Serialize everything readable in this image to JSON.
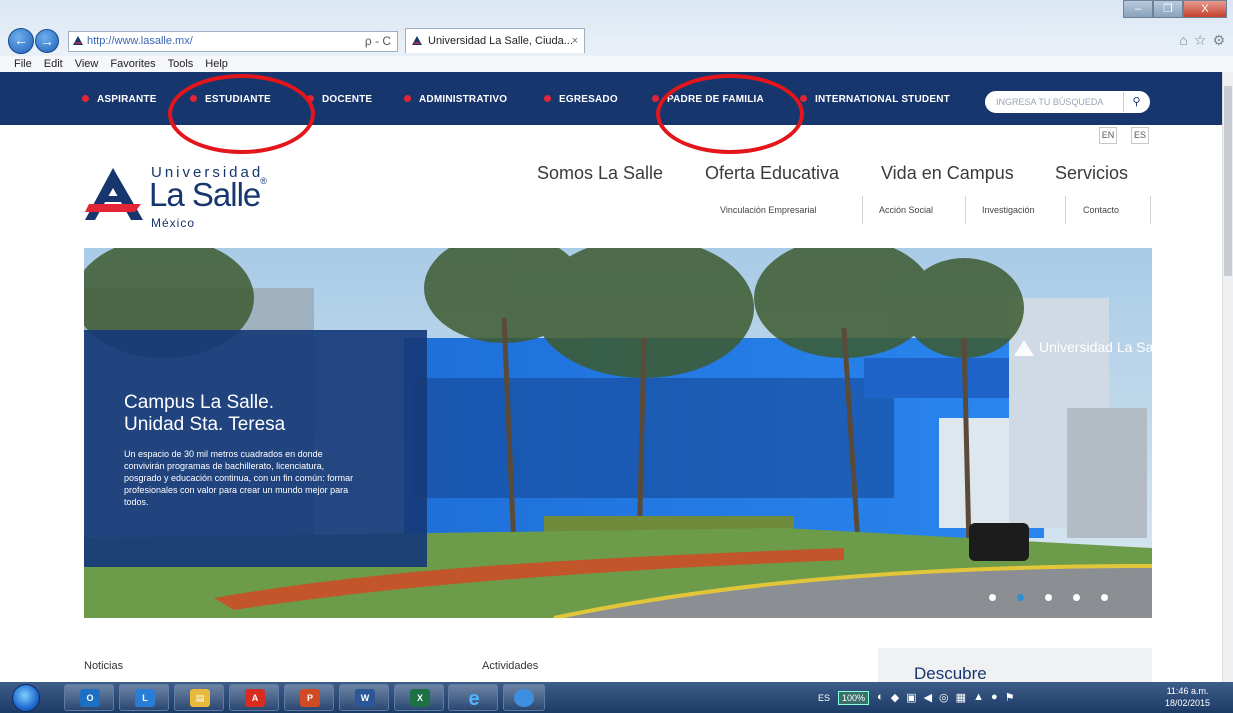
{
  "browser": {
    "window_controls": [
      "–",
      "❐",
      "X"
    ],
    "url": "http://www.lasalle.mx/",
    "address_tools": "ρ - C",
    "tab_title": "Universidad La Salle, Ciuda...",
    "tab_close": "×",
    "right_icons": [
      "⌂",
      "☆",
      "⚙"
    ],
    "menu": [
      "File",
      "Edit",
      "View",
      "Favorites",
      "Tools",
      "Help"
    ]
  },
  "site": {
    "colors": {
      "navy": "#17366e",
      "accent_red": "#e32635",
      "annotation": "#e4151b"
    },
    "topnav": [
      "ASPIRANTE",
      "ESTUDIANTE",
      "DOCENTE",
      "ADMINISTRATIVO",
      "EGRESADO",
      "PADRE DE FAMILIA",
      "INTERNATIONAL STUDENT"
    ],
    "search": {
      "placeholder": "INGRESA TU BÚSQUEDA",
      "icon": "search-icon"
    },
    "languages": [
      "EN",
      "ES"
    ],
    "logo": {
      "line1": "Universidad",
      "line2": "La Salle",
      "reg": "®",
      "line3": "México"
    },
    "mainnav": [
      "Somos La Salle",
      "Oferta Educativa",
      "Vida en Campus",
      "Servicios"
    ],
    "subnav": [
      "Vinculación Empresarial",
      "Acción Social",
      "Investigación",
      "Contacto"
    ],
    "hero": {
      "building_sign": "Universidad La Salle",
      "title_line1": "Campus La Salle.",
      "title_line2": "Unidad Sta. Teresa",
      "body": "Un espacio de 30 mil metros cuadrados en donde convivirán programas de bachillerato, licenciatura, posgrado y educación continua, con un fin común: formar profesionales con valor para crear un mundo mejor para todos.",
      "slides": 5,
      "active_slide": 2
    },
    "sections": {
      "news": "Noticias",
      "activities": "Actividades",
      "discover": "Descubre"
    }
  },
  "taskbar": {
    "apps": [
      {
        "name": "outlook",
        "label": "O",
        "color": "#1d6fc4"
      },
      {
        "name": "lync",
        "label": "L",
        "color": "#2a7dd6"
      },
      {
        "name": "explorer",
        "label": "▤",
        "color": "#e8b93c"
      },
      {
        "name": "acrobat",
        "label": "A",
        "color": "#d62d20"
      },
      {
        "name": "powerpoint",
        "label": "P",
        "color": "#d04a23"
      },
      {
        "name": "word",
        "label": "W",
        "color": "#2b5797"
      },
      {
        "name": "excel",
        "label": "X",
        "color": "#1e7145"
      }
    ],
    "language": "ES",
    "zoom": "100%",
    "time": "11:46 a.m.",
    "date": "18/02/2015"
  }
}
